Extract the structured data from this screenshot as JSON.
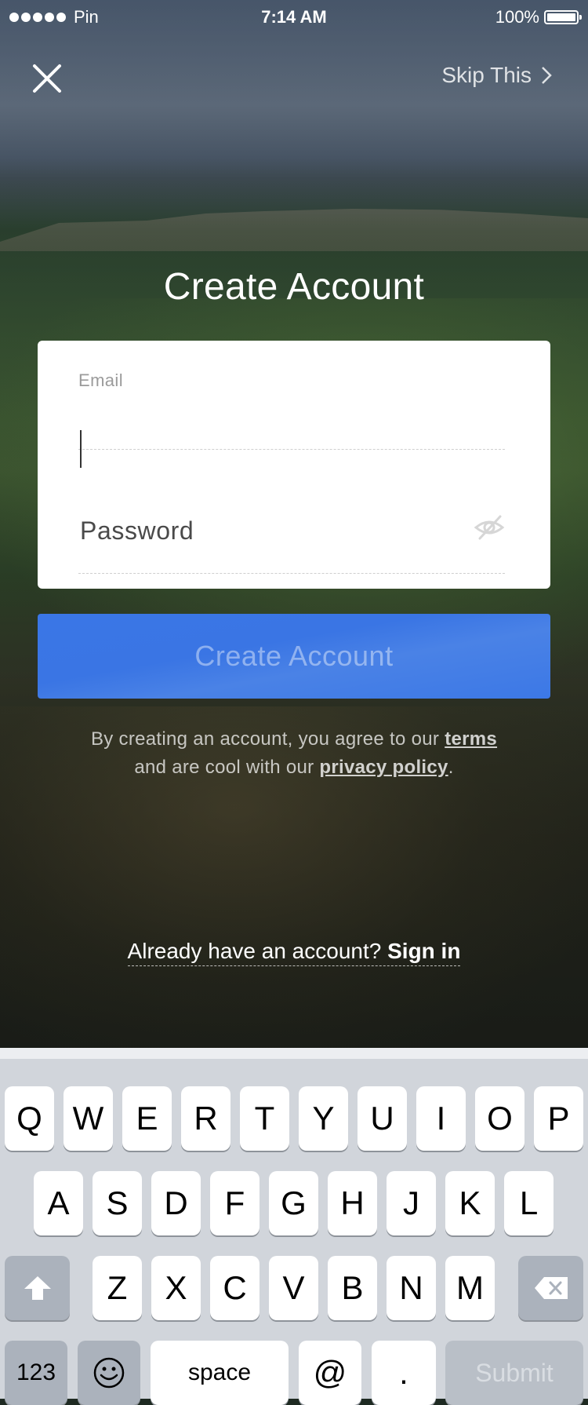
{
  "status_bar": {
    "carrier": "Pin",
    "time": "7:14 AM",
    "battery": "100%"
  },
  "nav": {
    "skip_label": "Skip This"
  },
  "page": {
    "title": "Create Account"
  },
  "form": {
    "email_label": "Email",
    "email_value": "",
    "password_placeholder": "Password"
  },
  "create_button_label": "Create Account",
  "legal": {
    "line1_prefix": "By creating an account, you agree to our ",
    "terms_link": "terms",
    "line2_prefix": "and are cool with our ",
    "privacy_link": "privacy policy",
    "line2_suffix": "."
  },
  "signin": {
    "prompt": "Already have an account? ",
    "link": "Sign in"
  },
  "keyboard": {
    "row1": [
      "Q",
      "W",
      "E",
      "R",
      "T",
      "Y",
      "U",
      "I",
      "O",
      "P"
    ],
    "row2": [
      "A",
      "S",
      "D",
      "F",
      "G",
      "H",
      "J",
      "K",
      "L"
    ],
    "row3": [
      "Z",
      "X",
      "C",
      "V",
      "B",
      "N",
      "M"
    ],
    "numbers_label": "123",
    "space_label": "space",
    "at_label": "@",
    "dot_label": ".",
    "submit_label": "Submit"
  }
}
